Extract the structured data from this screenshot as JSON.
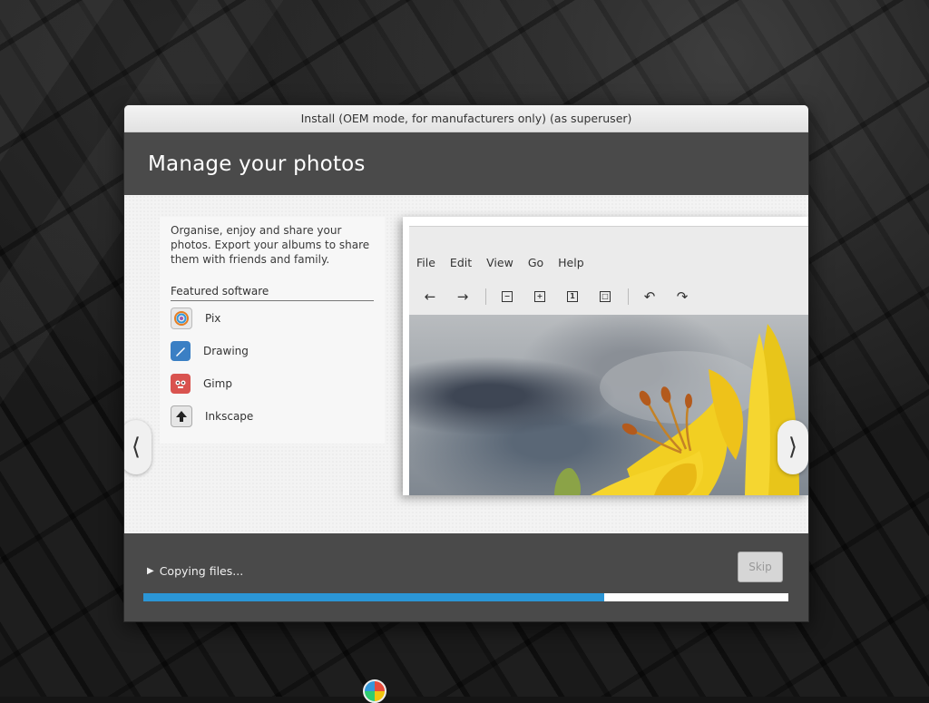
{
  "window": {
    "title": "Install (OEM mode, for manufacturers only) (as superuser)"
  },
  "slide": {
    "heading": "Manage your photos",
    "description": "Organise, enjoy and share your photos. Export your albums to share them with friends and family.",
    "featured_title": "Featured software",
    "apps": [
      {
        "label": "Pix",
        "icon": "pix-icon"
      },
      {
        "label": "Drawing",
        "icon": "drawing-icon"
      },
      {
        "label": "Gimp",
        "icon": "gimp-icon"
      },
      {
        "label": "Inkscape",
        "icon": "inkscape-icon"
      }
    ],
    "screenshot_menu": [
      "File",
      "Edit",
      "View",
      "Go",
      "Help"
    ]
  },
  "footer": {
    "status": "Copying files...",
    "skip_label": "Skip",
    "progress_percent": 71.5
  },
  "colors": {
    "header_bg": "#4a4a4a",
    "progress": "#2b96d6"
  }
}
